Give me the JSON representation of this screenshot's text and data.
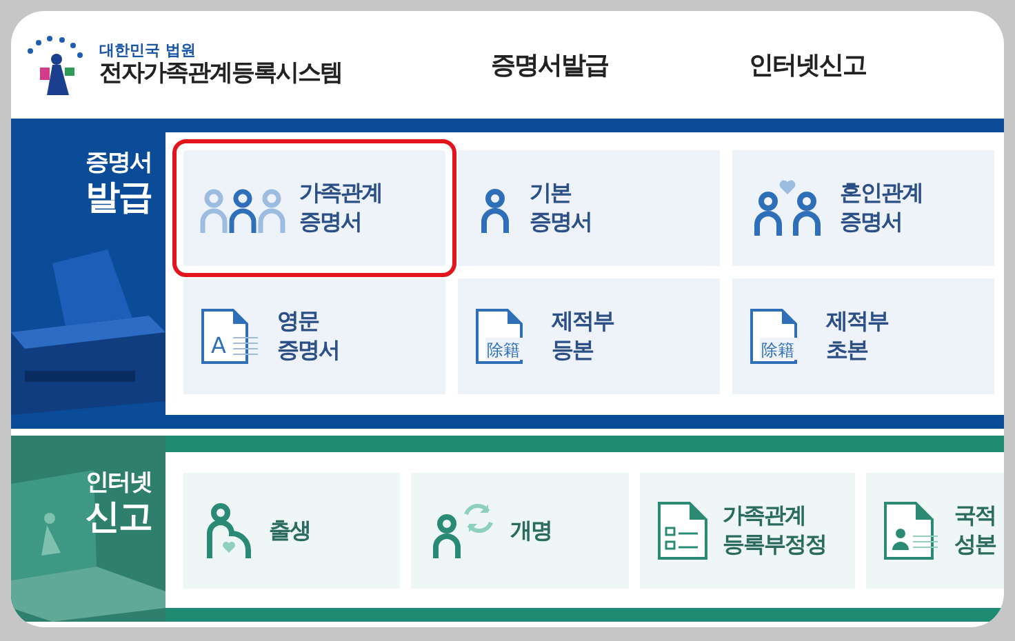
{
  "header": {
    "org": "대한민국 법원",
    "system": "전자가족관계등록시스템",
    "nav": [
      {
        "label": "증명서발급"
      },
      {
        "label": "인터넷신고"
      }
    ]
  },
  "sections": [
    {
      "kind": "certificate",
      "heading": [
        "증명서",
        "발급"
      ],
      "tiles": [
        {
          "kind": "family",
          "label": [
            "가족관계",
            "증명서"
          ],
          "selected": true
        },
        {
          "kind": "person",
          "label": [
            "기본",
            "증명서"
          ],
          "selected": false
        },
        {
          "kind": "couple",
          "label": [
            "혼인관계",
            "증명서"
          ],
          "selected": false
        },
        {
          "kind": "english-doc",
          "glyph": "A",
          "label": [
            "영문",
            "증명서"
          ],
          "selected": false
        },
        {
          "kind": "removed-doc",
          "glyph": "除籍",
          "label": [
            "제적부",
            "등본"
          ],
          "selected": false
        },
        {
          "kind": "removed-doc",
          "glyph": "除籍",
          "label": [
            "제적부",
            "초본"
          ],
          "selected": false
        }
      ]
    },
    {
      "kind": "report",
      "heading": [
        "인터넷",
        "신고"
      ],
      "tiles": [
        {
          "kind": "birth",
          "label": [
            "출생"
          ],
          "selected": false
        },
        {
          "kind": "rename",
          "label": [
            "개명"
          ],
          "selected": false
        },
        {
          "kind": "checklist-doc",
          "label": [
            "가족관계",
            "등록부정정"
          ],
          "selected": false
        },
        {
          "kind": "id-doc",
          "label": [
            "국적",
            "성본"
          ],
          "selected": false
        }
      ]
    }
  ]
}
